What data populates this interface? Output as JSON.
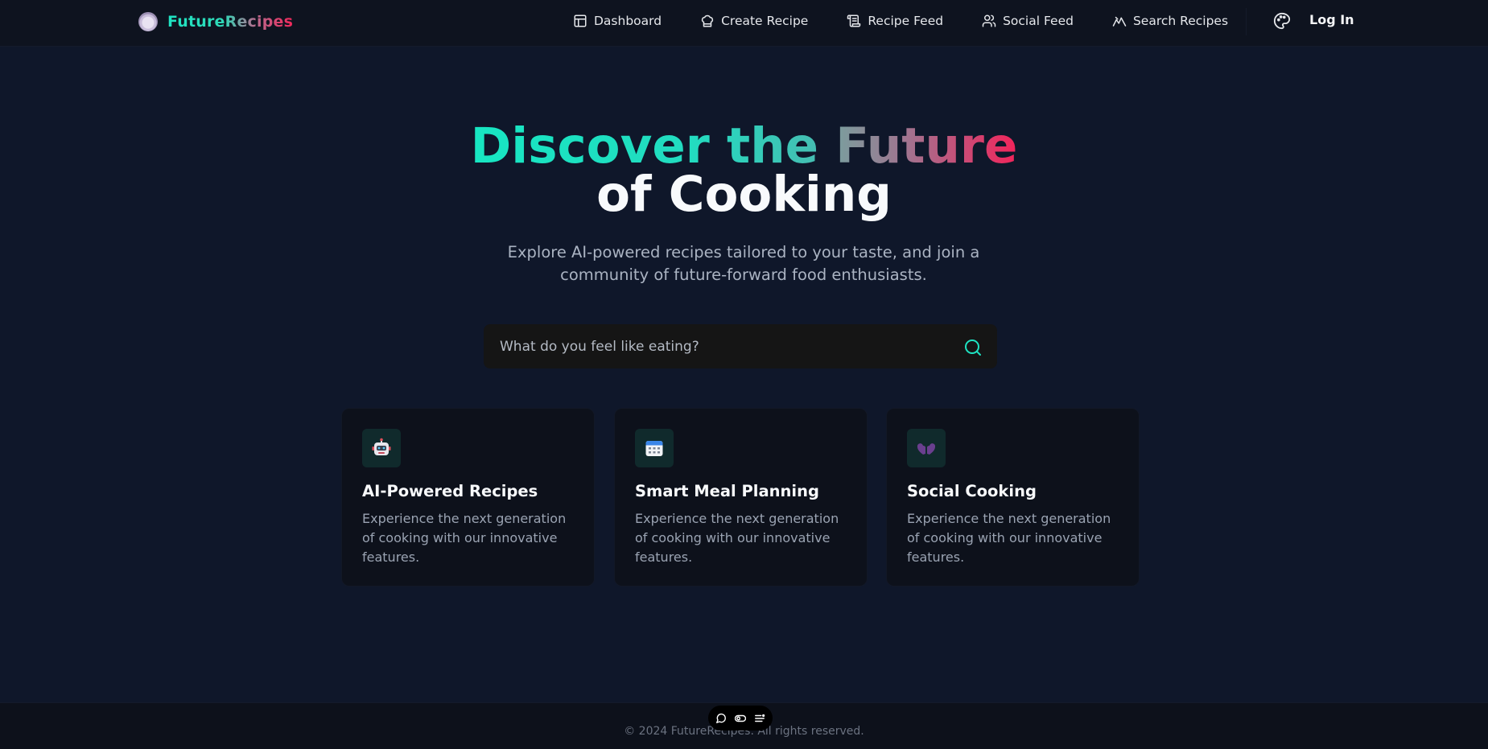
{
  "brand": {
    "name": "FutureRecipes",
    "icon": "plate-icon"
  },
  "nav": [
    {
      "label": "Dashboard",
      "icon": "dashboard-icon"
    },
    {
      "label": "Create Recipe",
      "icon": "chef-hat-icon"
    },
    {
      "label": "Recipe Feed",
      "icon": "scroll-icon"
    },
    {
      "label": "Social Feed",
      "icon": "users-icon"
    },
    {
      "label": "Search Recipes",
      "icon": "chart-icon"
    }
  ],
  "header": {
    "theme_icon": "palette-icon",
    "login_label": "Log In"
  },
  "hero": {
    "title_part1": "Discover the ",
    "title_part2": "Future",
    "title_line2": "of Cooking",
    "subtitle": "Explore AI-powered recipes tailored to your taste, and join a community of future-forward food enthusiasts."
  },
  "search": {
    "placeholder": "What do you feel like eating?",
    "value": ""
  },
  "features": [
    {
      "title": "AI-Powered Recipes",
      "description": "Experience the next generation of cooking with our innovative features.",
      "icon": "robot-icon"
    },
    {
      "title": "Smart Meal Planning",
      "description": "Experience the next generation of cooking with our innovative features.",
      "icon": "calendar-icon"
    },
    {
      "title": "Social Cooking",
      "description": "Experience the next generation of cooking with our innovative features.",
      "icon": "hearts-icon"
    }
  ],
  "footer": {
    "copyright": "© 2024 FutureRecipes. All rights reserved."
  },
  "colors": {
    "accent": "#1ee3c2",
    "accent_pink": "#f0275a",
    "background": "#0f172a"
  }
}
